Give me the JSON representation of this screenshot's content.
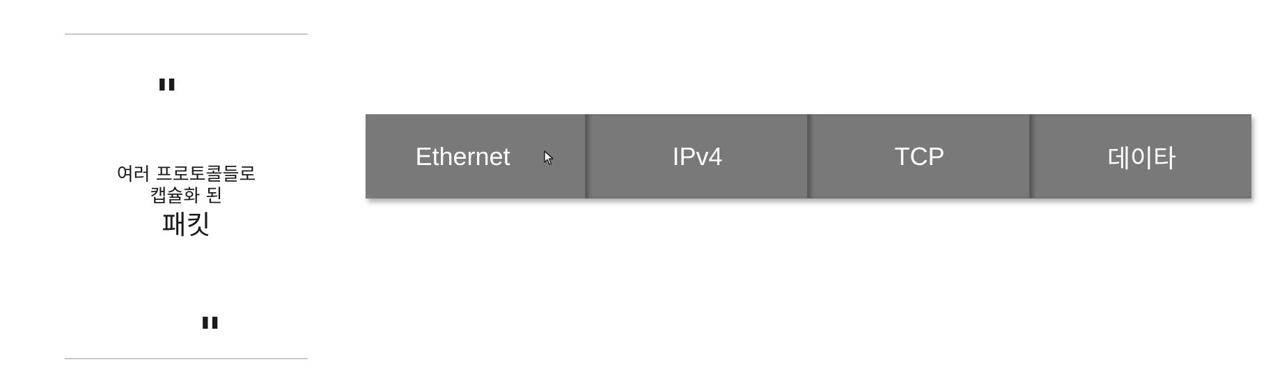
{
  "quote_panel": {
    "open_quote": "\"",
    "close_quote": "\"",
    "line1": "여러 프로토콜들로",
    "line2": "캡슐화 된",
    "emphasis": "패킷"
  },
  "packet": {
    "segments": [
      {
        "label": "Ethernet"
      },
      {
        "label": "IPv4"
      },
      {
        "label": "TCP"
      },
      {
        "label": "데이타"
      }
    ],
    "segment_color": "#797979",
    "text_color": "#ffffff"
  },
  "cursor": {
    "icon": "mouse-pointer-icon"
  }
}
